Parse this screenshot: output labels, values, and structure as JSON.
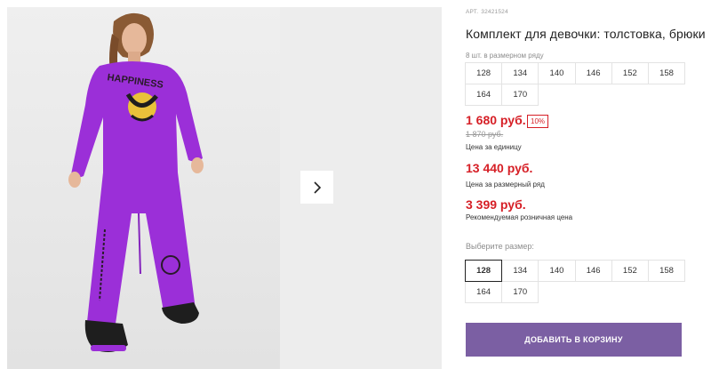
{
  "product": {
    "article_label": "АРТ.",
    "article_number": "32421524",
    "title": "Комплект для девочки: толстовка, брюки",
    "print_text": "HAPPINESS"
  },
  "pack": {
    "note": "8 шт. в размерном ряду",
    "sizes": [
      "128",
      "134",
      "140",
      "146",
      "152",
      "158",
      "164",
      "170"
    ]
  },
  "pricing": {
    "price": "1 680 руб.",
    "discount": "10%",
    "old_price": "1 870 руб.",
    "unit_note": "Цена за единицу",
    "row_price": "13 440 руб.",
    "row_note": "Цена за размерный ряд",
    "rrp": "3 399 руб.",
    "rrp_note": "Рекомендуемая розничная цена"
  },
  "size_select": {
    "label": "Выберите размер:",
    "options": [
      "128",
      "134",
      "140",
      "146",
      "152",
      "158",
      "164",
      "170"
    ],
    "selected": "128"
  },
  "actions": {
    "add_to_cart": "ДОБАВИТЬ В КОРЗИНУ"
  },
  "colors": {
    "price_red": "#d61f26",
    "button_purple": "#7b5fa3",
    "outfit_purple": "#9b2fd8"
  },
  "icons": {
    "next": "chevron-right-icon"
  }
}
